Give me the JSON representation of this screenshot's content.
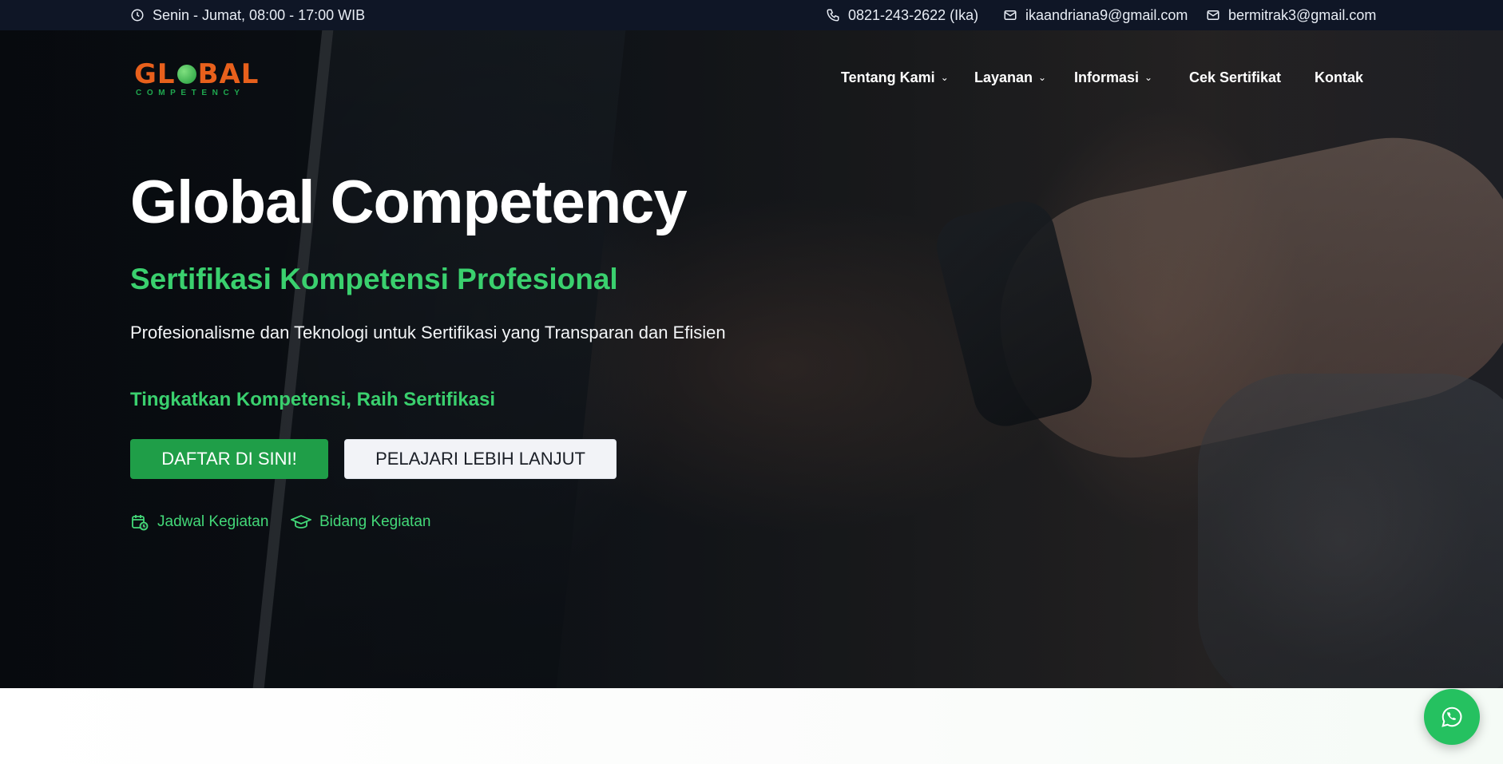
{
  "topbar": {
    "hours": "Senin - Jumat, 08:00 - 17:00 WIB",
    "phone": "0821-243-2622 (Ika)",
    "email1": "ikaandriana9@gmail.com",
    "email2": "bermitrak3@gmail.com",
    "icons": [
      "clock-icon",
      "phone-icon",
      "mail-icon",
      "mail-icon"
    ]
  },
  "logo": {
    "text_left": "GL",
    "text_right": "BAL",
    "tagline": "COMPETENCY",
    "colors": {
      "word": "#e8601c",
      "tagline": "#1fa84f"
    }
  },
  "nav": {
    "items": [
      {
        "label": "Tentang Kami",
        "has_dropdown": true
      },
      {
        "label": "Layanan",
        "has_dropdown": true
      },
      {
        "label": "Informasi",
        "has_dropdown": true
      },
      {
        "label": "Cek Sertifikat",
        "has_dropdown": false
      },
      {
        "label": "Kontak",
        "has_dropdown": false
      }
    ],
    "chevron": "⌄"
  },
  "hero": {
    "title": "Global Competency",
    "subtitle": "Sertifikasi Kompetensi Profesional",
    "description": "Profesionalisme dan Teknologi untuk Sertifikasi yang Transparan dan Efisien",
    "cta_heading": "Tingkatkan Kompetensi, Raih Sertifikasi",
    "primary_button": "DAFTAR DI SINI!",
    "secondary_button": "PELAJARI LEBIH LANJUT",
    "quick_links": [
      {
        "label": "Jadwal Kegiatan",
        "icon": "calendar-clock-icon"
      },
      {
        "label": "Bidang Kegiatan",
        "icon": "graduation-cap-icon"
      }
    ]
  },
  "floating": {
    "icon": "whatsapp-icon"
  },
  "colors": {
    "topbar_bg": "#0f1626",
    "accent_green": "#3ad06e",
    "button_green": "#1f9e48",
    "whatsapp": "#25c160"
  }
}
